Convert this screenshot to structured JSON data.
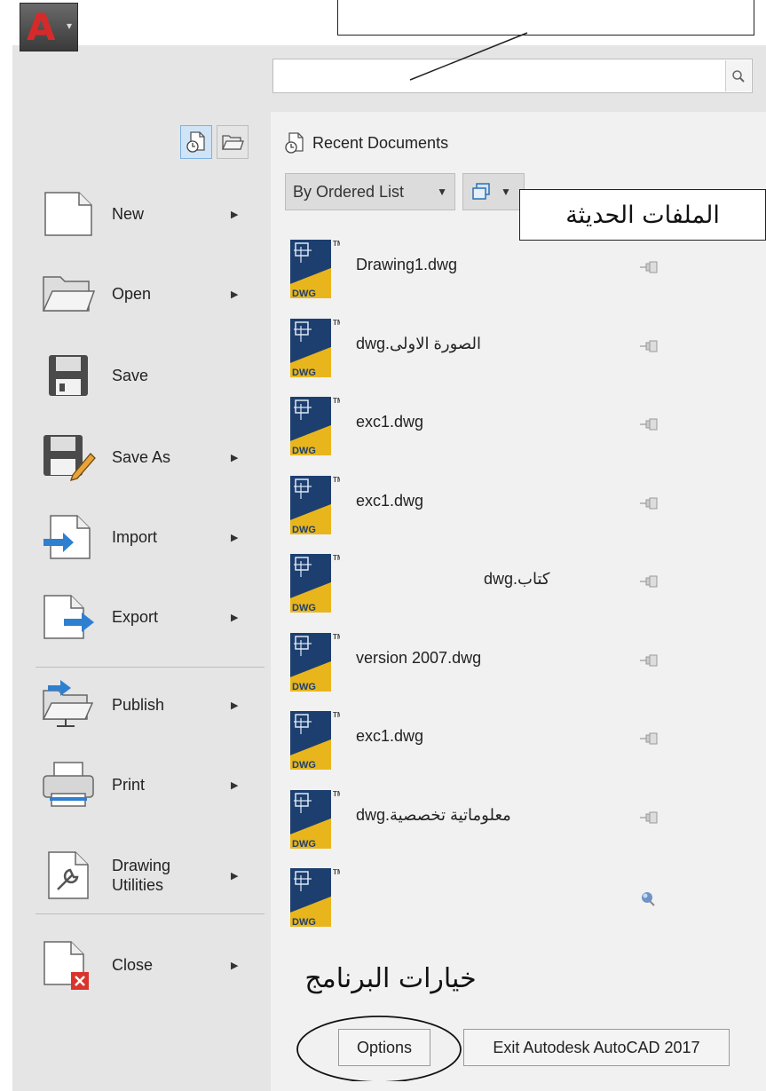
{
  "app_button": {
    "letter": "A",
    "arrow": "▾",
    "icon": "autocad-logo-icon"
  },
  "search": {
    "value": "",
    "placeholder": "",
    "icon": "search-icon"
  },
  "annotations": {
    "top_callout": "",
    "recent_callout": "الملفات الحديثة",
    "options_caption": "خيارات البرنامج"
  },
  "view_toggles": [
    {
      "name": "recent-documents",
      "icon": "recent-documents-icon",
      "active": true
    },
    {
      "name": "open-documents",
      "icon": "folder-icon",
      "active": false
    }
  ],
  "menu": {
    "items": [
      {
        "label": "New",
        "icon": "new-document-icon",
        "has_submenu": true
      },
      {
        "label": "Open",
        "icon": "open-folder-icon",
        "has_submenu": true
      },
      {
        "label": "Save",
        "icon": "floppy-disk-icon",
        "has_submenu": false
      },
      {
        "label": "Save As",
        "icon": "save-as-icon",
        "has_submenu": true
      },
      {
        "label": "Import",
        "icon": "import-icon",
        "has_submenu": true
      },
      {
        "label": "Export",
        "icon": "export-icon",
        "has_submenu": true
      },
      {
        "label": "Publish",
        "icon": "publish-icon",
        "has_submenu": true
      },
      {
        "label": "Print",
        "icon": "printer-icon",
        "has_submenu": true
      },
      {
        "label": "Drawing\nUtilities",
        "icon": "wrench-icon",
        "has_submenu": true
      },
      {
        "label": "Close",
        "icon": "close-document-icon",
        "has_submenu": true
      }
    ],
    "submenu_arrow": "▶"
  },
  "recent": {
    "title": "Recent Documents",
    "sort_dropdown": "By Ordered List",
    "dropdown_arrow": "▼",
    "files": [
      {
        "name": "Drawing1.dwg",
        "pin": "pin-icon"
      },
      {
        "name": "الصورة الاولى.dwg",
        "pin": "pin-icon"
      },
      {
        "name": "exc1.dwg",
        "pin": "pin-icon"
      },
      {
        "name": "exc1.dwg",
        "pin": "pin-icon"
      },
      {
        "name": "كتاب.dwg",
        "pin": "pin-icon"
      },
      {
        "name": "version 2007.dwg",
        "pin": "pin-icon"
      },
      {
        "name": "exc1.dwg",
        "pin": "pin-icon"
      },
      {
        "name": "معلوماتية تخصصية.dwg",
        "pin": "pin-icon"
      },
      {
        "name": "",
        "pin": "pinned-icon"
      }
    ],
    "file_icon_label": "DWG",
    "file_icon_tm": "TM"
  },
  "buttons": {
    "options": "Options",
    "exit": "Exit Autodesk AutoCAD 2017"
  },
  "colors": {
    "panel": "#e5e5e5",
    "pane": "#f1f1f1",
    "accent": "#2f7fd0",
    "dwg_yellow": "#e8b61c"
  }
}
